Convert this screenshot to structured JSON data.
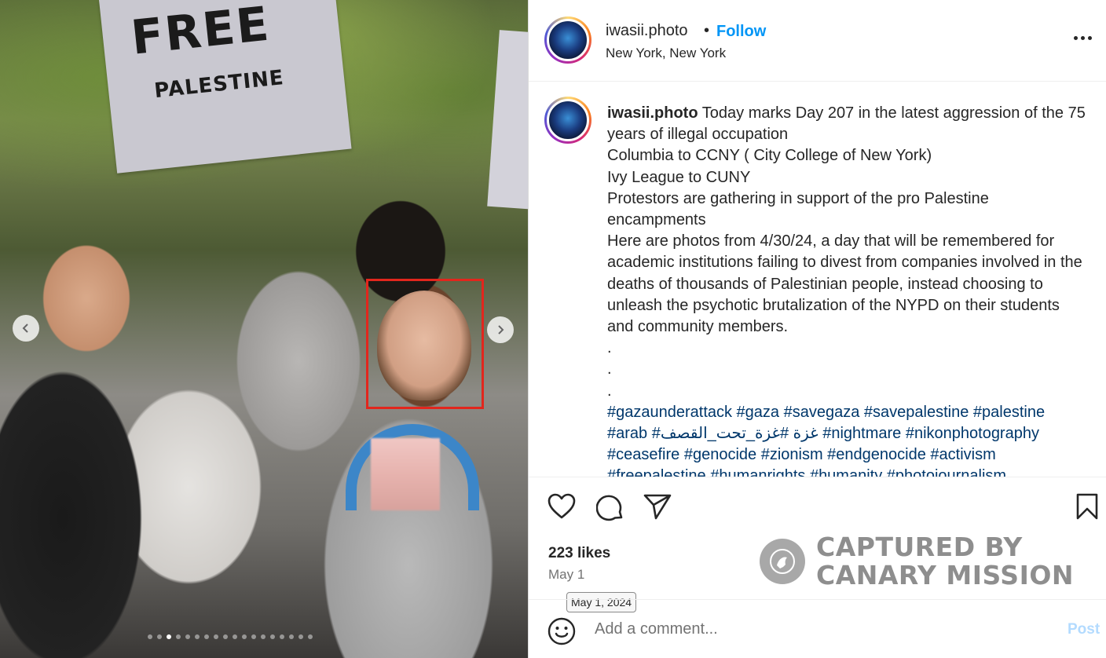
{
  "photo": {
    "sign_line1": "FREE",
    "sign_line2": "PALESTINE",
    "carousel_dots": 18,
    "carousel_active_index": 2
  },
  "header": {
    "username": "iwasii.photo",
    "separator": "•",
    "follow_label": "Follow",
    "location": "New York, New York"
  },
  "caption": {
    "username": "iwasii.photo",
    "lines": [
      "Today marks Day 207 in the latest aggression of the 75 years of illegal occupation",
      "Columbia to CCNY ( City College of New York)",
      "Ivy League to CUNY",
      "Protestors are gathering in support of the pro Palestine encampments",
      "Here are photos from 4/30/24, a day that will be remembered for academic institutions failing to divest from companies involved in the deaths of thousands of Palestinian people, instead choosing to unleash the psychotic brutalization of the NYPD on their students and community members.",
      ".",
      ".",
      "."
    ],
    "hashtags": "#gazaunderattack #gaza #savegaza #savepalestine #palestine #arab #غزة #غزة_تحت_القصف #nightmare #nikonphotography #ceasefire #genocide #zionism #endgenocide #activism #freepalestine #humanrights #humanity #photojournalism"
  },
  "actions": {
    "likes": "223 likes",
    "date": "May 1",
    "date_tooltip": "May 1, 2024"
  },
  "watermark": {
    "line1": "CAPTURED BY",
    "line2": "CANARY MISSION"
  },
  "comment": {
    "placeholder": "Add a comment...",
    "post_label": "Post"
  },
  "colors": {
    "accent": "#0095f6",
    "hashtag": "#00376b",
    "highlight_box": "#e2261d",
    "post_disabled": "#b3dbff"
  }
}
